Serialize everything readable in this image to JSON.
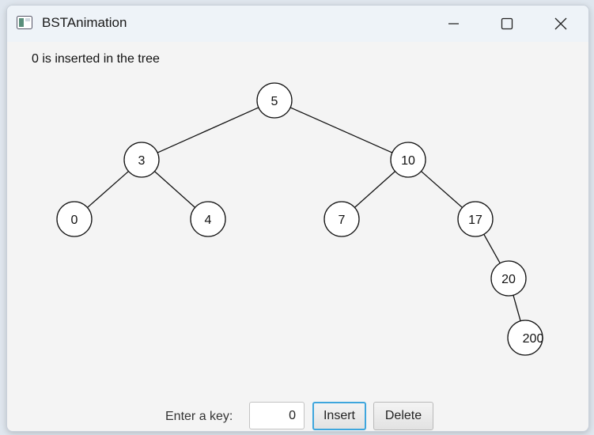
{
  "window": {
    "title": "BSTAnimation"
  },
  "status_message": "0 is inserted in the tree",
  "tree": {
    "nodes": [
      {
        "key": "5"
      },
      {
        "key": "3"
      },
      {
        "key": "10"
      },
      {
        "key": "0"
      },
      {
        "key": "4"
      },
      {
        "key": "7"
      },
      {
        "key": "17"
      },
      {
        "key": "20"
      },
      {
        "key": "200"
      }
    ],
    "edges": [
      [
        "5",
        "3"
      ],
      [
        "5",
        "10"
      ],
      [
        "3",
        "0"
      ],
      [
        "3",
        "4"
      ],
      [
        "10",
        "7"
      ],
      [
        "10",
        "17"
      ],
      [
        "17",
        "20"
      ],
      [
        "20",
        "200"
      ]
    ]
  },
  "controls": {
    "key_label": "Enter a key:",
    "key_value": "0",
    "insert_label": "Insert",
    "delete_label": "Delete"
  }
}
